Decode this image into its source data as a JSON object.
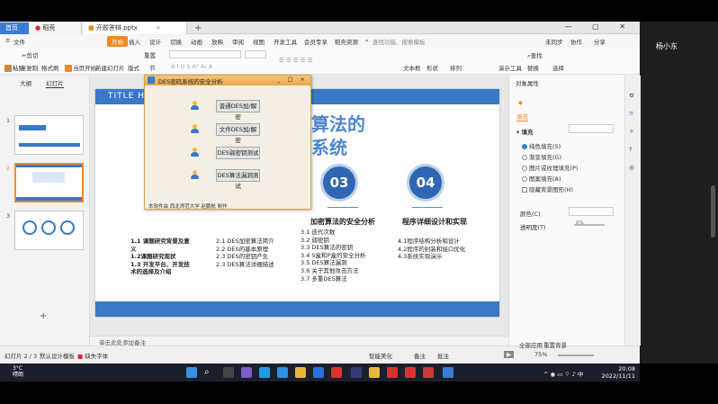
{
  "tabs": {
    "home": "首页",
    "docer": "稻壳",
    "document": "开题答辩.pptx",
    "add": "+"
  },
  "window_controls": "— ▢ ✕",
  "ribbon_tabs": [
    "文件",
    "开始",
    "插入",
    "设计",
    "切换",
    "动画",
    "放映",
    "审阅",
    "视图",
    "开发工具",
    "会员专享",
    "稻壳资源"
  ],
  "ribbon_active": "开始",
  "search_placeholder": "查找功能、搜索模板",
  "ribbon_right": [
    "未同步",
    "协作",
    "分享"
  ],
  "ribbon_tools": [
    "粘贴",
    "剪切",
    "复制",
    "格式刷",
    "当页开始",
    "新建幻灯片",
    "版式",
    "节",
    "重置",
    "文本框",
    "形状",
    "排列",
    "演示工具",
    "查找",
    "替换",
    "选择"
  ],
  "thumbpane": {
    "tabs": [
      "大纲",
      "幻灯片"
    ],
    "numbers": [
      "1",
      "2",
      "3"
    ]
  },
  "slide": {
    "header_title": "TITLE HERE",
    "big_title_line1": "算法的",
    "big_title_line2": "系统",
    "circle3": "03",
    "circle4": "04",
    "sec3_head": "加密算法的安全分析",
    "sec4_head": "程序详细设计和实现",
    "col1": [
      "1.1 课题研究背景及意",
      "义",
      "1.2课题研究现状",
      "1.3 开发平台、开发技",
      "术的选择及介绍"
    ],
    "col2": [
      "2.1 DES加密算法简介",
      "2.2 DES的基本原理",
      "2.3 DES的密钥产生",
      "2.3 DES算法详细描述"
    ],
    "col3": [
      "3.1 迭代次数",
      "3.2 弱密钥",
      "3.3 DES算法的密钥",
      "3.4 S盒和P盒的安全分析",
      "3.5 DES算法漏洞",
      "3.6 关于其他攻击方法",
      "3.7 多重DES算法"
    ],
    "col4": [
      "4.1程序结构分析和设计",
      "4.2程序的封装和接口优化",
      "4.3系统实现演示"
    ]
  },
  "dialog": {
    "title": "DES密码系统的安全分析",
    "controls": "_ □ ×",
    "buttons": [
      "普通DES加/解密",
      "文件DES加/解密",
      "DES弱密钥测试",
      "DES算法漏洞测试"
    ],
    "footer": "本软件由  西北师范大学 赵鹏航  制作"
  },
  "notes_placeholder": "单击此处添加备注",
  "props": {
    "title": "对象属性",
    "fill_tab": "填充",
    "fill_section": "填充",
    "options": [
      "纯色填充(S)",
      "渐变填充(G)",
      "图片或纹理填充(P)",
      "图案填充(A)",
      "隐藏背景图形(H)"
    ],
    "selected_option": "纯色填充(S)",
    "color_label": "颜色(C)",
    "transparency_label": "透明度(T)",
    "transparency_value": "0%"
  },
  "status": {
    "slide_count": "幻灯片 2 / 3",
    "theme": "默认设计模板",
    "font_missing": "缺失字体",
    "smart_beautify": "智能美化",
    "notes": "备注",
    "comments": "批注",
    "zoom": "75%",
    "apply_all": "全部应用",
    "reset_bg": "重置背景"
  },
  "taskbar": {
    "weather_temp": "3°C",
    "weather_desc": "晴朗",
    "time": "20:08",
    "date": "2022/11/11"
  },
  "side_user": "杨小东"
}
